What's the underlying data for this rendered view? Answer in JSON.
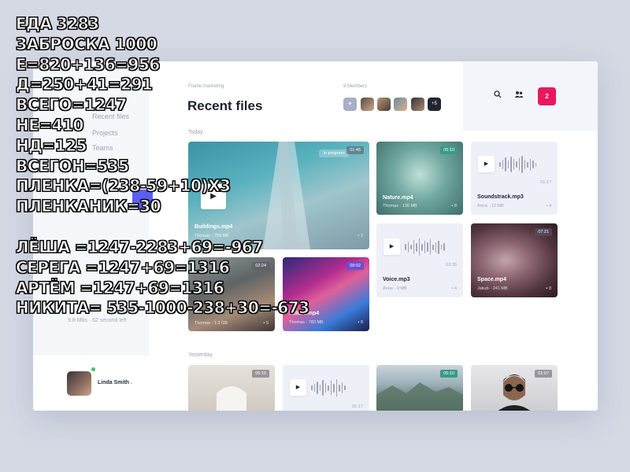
{
  "app": {
    "breadcrumb": "Frame marketing",
    "title": "Recent files",
    "members_label": "9 Members",
    "members_more": "+5",
    "notification_count": "2",
    "accent": "#5b5ff0",
    "notify_color": "#e8185c"
  },
  "sidebar": {
    "items": [
      {
        "label": "Recent files",
        "active": true
      },
      {
        "label": "Projects"
      },
      {
        "label": "Teams"
      }
    ],
    "stats": "9.8 Mbs · 62 second left",
    "user": {
      "name": "Linda Smith"
    }
  },
  "sections": {
    "today": "Today",
    "yesterday": "Yesterday"
  },
  "files": [
    {
      "name": "Buildings.mp4",
      "owner": "Thomas",
      "size": "759 MB",
      "comments": "2",
      "duration": "01:45",
      "status": "In progress",
      "kind": "video"
    },
    {
      "name": "Nature.mp4",
      "owner": "Thomas",
      "size": "136 MB",
      "comments": "8",
      "duration": "05:10",
      "kind": "video"
    },
    {
      "name": "Soundstrack.mp3",
      "owner": "Anna",
      "size": "12 MB",
      "comments": "4",
      "duration": "01:17",
      "kind": "audio"
    },
    {
      "name": "",
      "owner": "Thomas",
      "size": "1.3 GB",
      "comments": "5",
      "duration": "02:24",
      "kind": "video"
    },
    {
      "name": "Future.mp4",
      "owner": "Thomas",
      "size": "783 MB",
      "comments": "8",
      "duration": "08:02",
      "kind": "video"
    },
    {
      "name": "Voice.mp3",
      "owner": "Anna",
      "size": "9 MB",
      "comments": "4",
      "duration": "02:35",
      "kind": "audio"
    },
    {
      "name": "Space.mp4",
      "owner": "Jakub",
      "size": "241 MB",
      "comments": "8",
      "duration": "07:21",
      "kind": "video"
    }
  ],
  "yesterday_files": [
    {
      "duration": "05:10",
      "kind": "video"
    },
    {
      "duration": "01:17",
      "kind": "audio"
    },
    {
      "duration": "05:10",
      "kind": "video"
    },
    {
      "duration": "01:07",
      "kind": "video"
    }
  ],
  "overlay_text": [
    "ЕДА 3283",
    "ЗАБРОСКА 1000",
    "Е=820+136=956",
    "Д=250+41=291",
    "ВСЕГО=1247",
    "НЕ=410",
    "НД=125",
    "ВСЕГОН=535",
    "ПЛЕНКА=(238-59+10)Х3",
    "ПЛЕНКАНИК=30",
    "ЛЁША =1247-2283+69=-967",
    "СЕРЕГА =1247+69=1316",
    "АРТЁМ =1247+69=1316",
    "НИКИТА= 535-1000-238+30=-673"
  ],
  "icons": [
    "search-icon",
    "people-icon",
    "plus-icon",
    "play-icon",
    "comment-icon",
    "chevron-down-icon"
  ]
}
